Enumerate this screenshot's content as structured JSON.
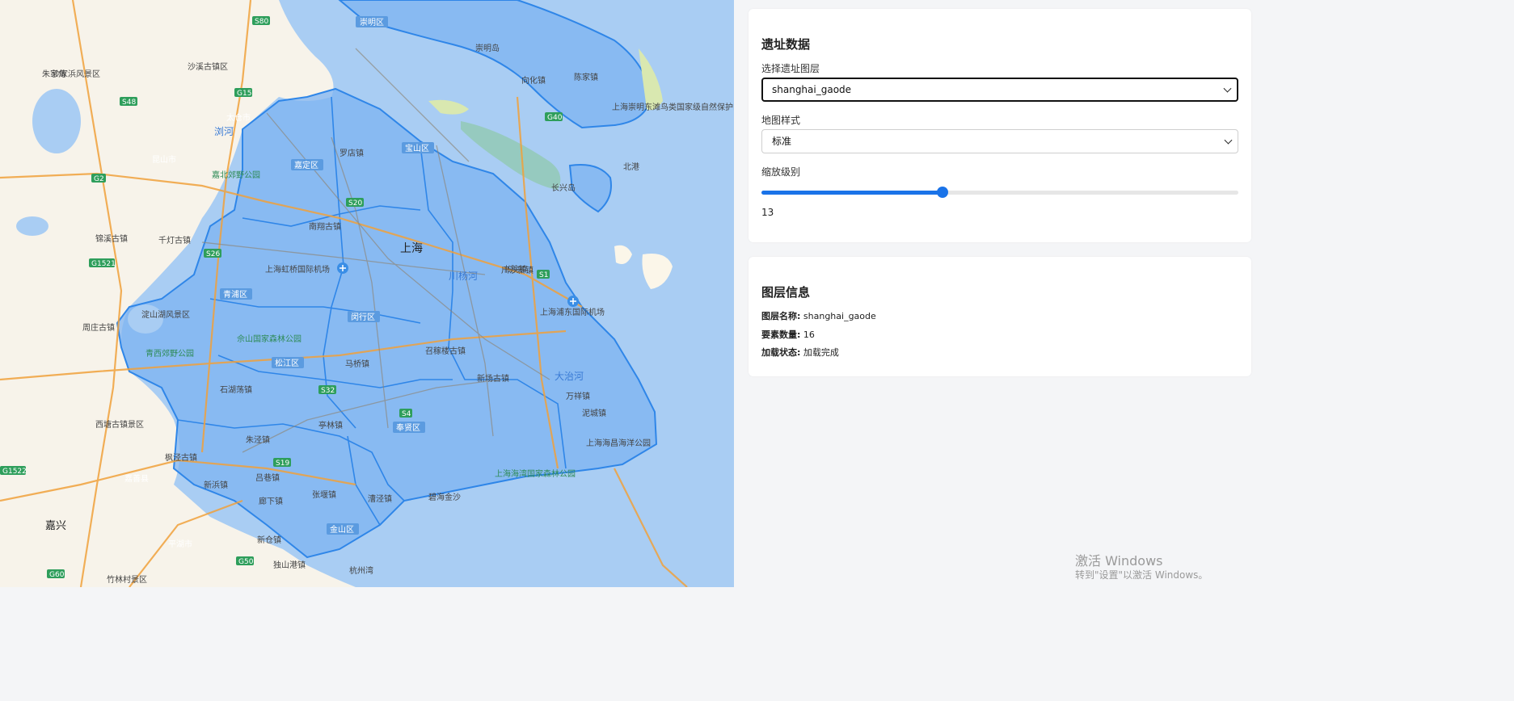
{
  "map": {
    "district_labels": [
      "崇明区",
      "宝山区",
      "嘉定区",
      "青浦区",
      "闵行区",
      "松江区",
      "奉贤区",
      "金山区"
    ],
    "place_labels": [
      "上海",
      "上海虹桥国际机场",
      "上海浦东国际机场",
      "南翔古镇",
      "召稼楼古镇",
      "新场古镇",
      "川杨河",
      "大治河",
      "淀山湖风景区",
      "青西郊野公园",
      "佘山国家森林公园",
      "碧海金沙",
      "上海海湾国家森林公园",
      "上海海昌海洋公园",
      "上海崇明东滩鸟类国家级自然保护区",
      "朱家角",
      "枫泾古镇",
      "周庄古镇",
      "千灯古镇",
      "锦溪古镇",
      "西塘古镇景区",
      "昆山市",
      "太仓市",
      "嘉善县",
      "平湖市",
      "嘉兴",
      "沙溪古镇区",
      "长兴岛",
      "北港",
      "崇明岛",
      "嘉北郊野公园",
      "沙家浜风景区",
      "罗店镇",
      "向化镇",
      "陈家镇",
      "杭州湾",
      "竹林村景区",
      "石湖荡镇",
      "亭林镇",
      "马桥镇",
      "万祥镇",
      "书院镇",
      "新仓镇",
      "独山港镇",
      "泥城镇",
      "浏河",
      "川沙新镇",
      "吕巷镇",
      "廊下镇",
      "张堰镇",
      "漕泾镇",
      "新浜镇",
      "朱泾镇"
    ],
    "road_shields": [
      "S80",
      "G15",
      "S48",
      "G2",
      "S20",
      "S26",
      "G1521",
      "G40",
      "S1",
      "S32",
      "S4",
      "S19",
      "G1522",
      "G60",
      "G50"
    ]
  },
  "site_data": {
    "title": "遗址数据",
    "layer_label": "选择遗址图层",
    "layer_value": "shanghai_gaode",
    "style_label": "地图样式",
    "style_value": "标准",
    "zoom_label": "缩放级别",
    "zoom_value": "13",
    "zoom_fraction": 0.38
  },
  "layer_info": {
    "title": "图层信息",
    "name_label": "图层名称:",
    "name_value": "shanghai_gaode",
    "count_label": "要素数量:",
    "count_value": "16",
    "status_label": "加载状态:",
    "status_value": "加载完成"
  },
  "watermark": {
    "line1": "激活 Windows",
    "line2": "转到\"设置\"以激活 Windows。"
  },
  "colors": {
    "accent": "#1a73e8",
    "sea": "#a9cdf3",
    "land": "#f7f3ea",
    "region_fill": "#7eb3f2",
    "region_stroke": "#2f86e8",
    "district_label_bg": "#5b9be0"
  }
}
